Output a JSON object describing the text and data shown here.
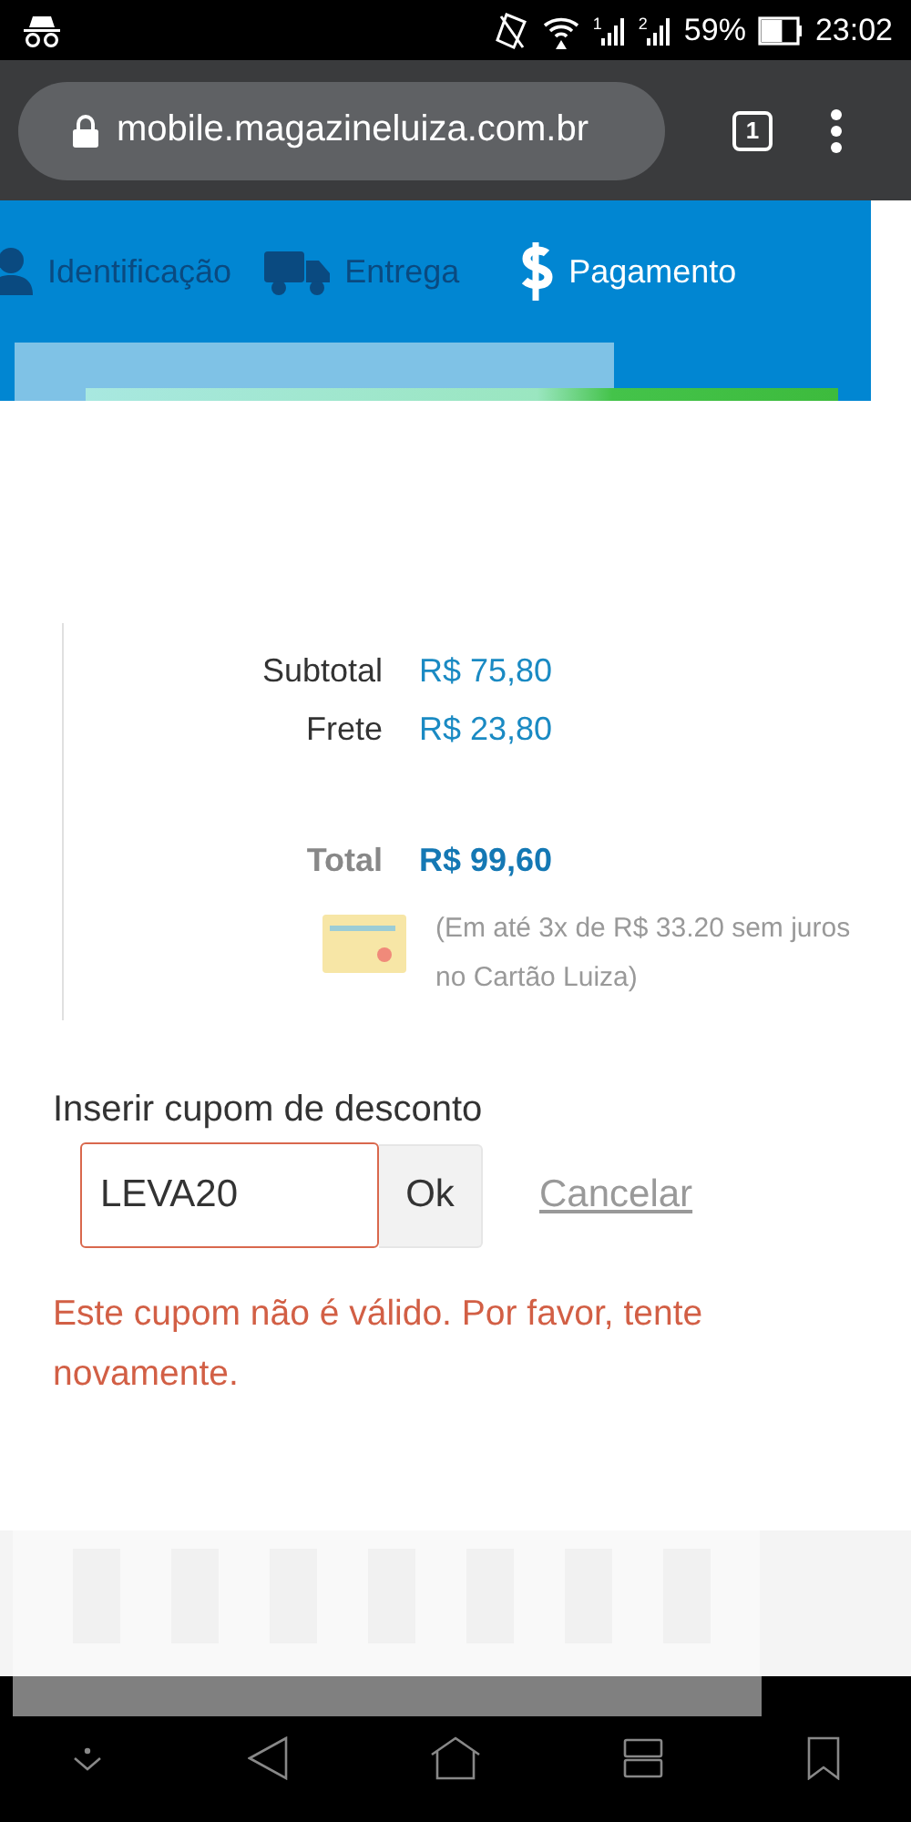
{
  "status_bar": {
    "sim_slots": [
      "1",
      "2"
    ],
    "battery": "59%",
    "time": "23:02"
  },
  "browser": {
    "url": "mobile.magazineluiza.com.br",
    "tab_count": "1"
  },
  "steps": [
    {
      "kind": "person",
      "label": "Identificação",
      "selected": false
    },
    {
      "kind": "truck",
      "label": "Entrega",
      "selected": false
    },
    {
      "kind": "money",
      "label": "Pagamento",
      "selected": true
    }
  ],
  "progress": {
    "level": 1
  },
  "summary": [
    {
      "kind": "line",
      "label": "Subtotal",
      "value": "R$ 75,80"
    },
    {
      "kind": "line",
      "label": "Frete",
      "value": "R$ 23,80"
    },
    {
      "kind": "total",
      "label": "Total",
      "value": "R$ 99,60"
    }
  ],
  "installments": "(Em até 3x de R$ 33.20 sem juros no Cartão Luiza)",
  "coupon": {
    "label": "Inserir cupom de desconto",
    "value": "LEVA20",
    "invalid": true,
    "button": "Ok",
    "cancel": "Cancelar",
    "error": "Este cupom não é válido. Por favor, tente novamente."
  }
}
